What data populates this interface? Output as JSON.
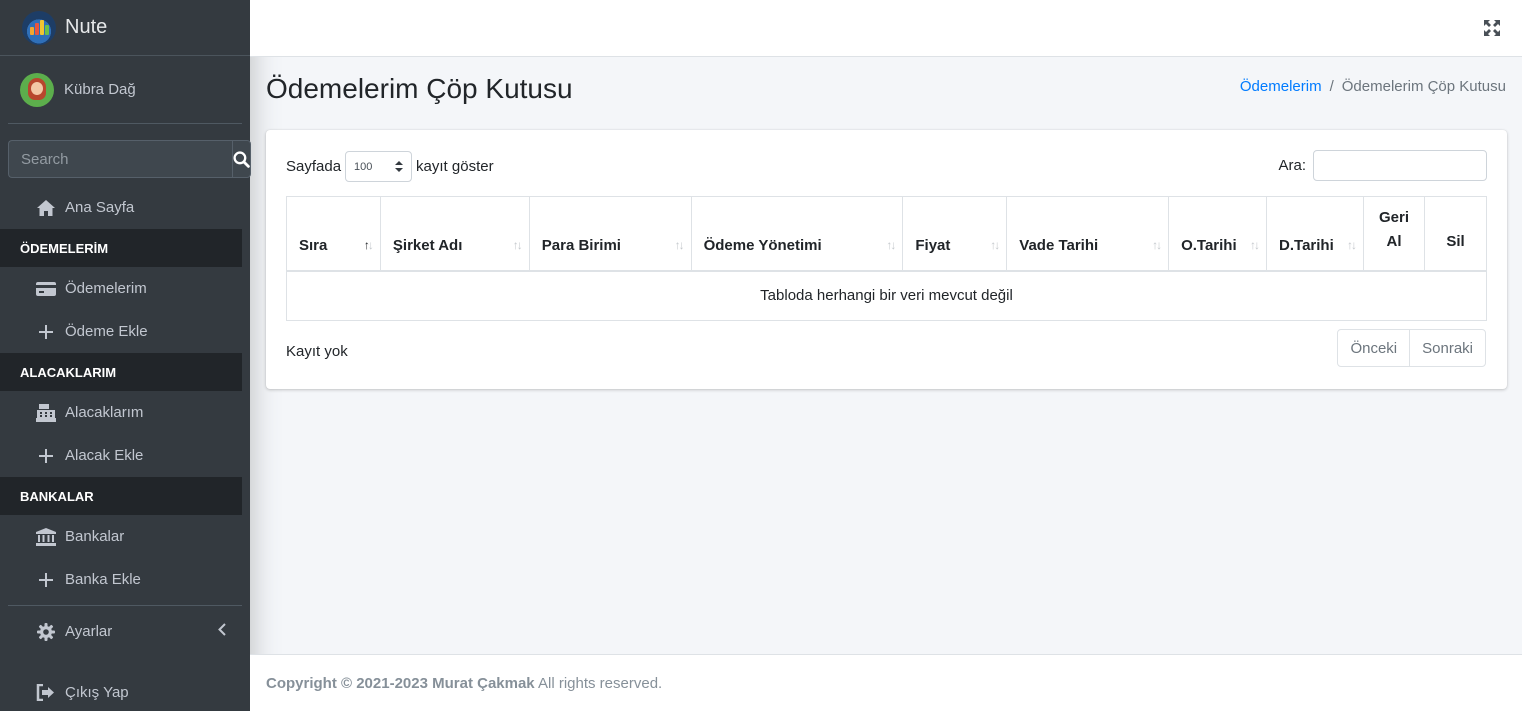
{
  "brand": {
    "name": "Nute",
    "icon": "chart-logo-icon"
  },
  "user": {
    "name": "Kübra Dağ",
    "icon": "avatar"
  },
  "search": {
    "placeholder": "Search",
    "icon": "search-icon"
  },
  "sidebar": {
    "home": {
      "label": "Ana Sayfa",
      "icon": "home-icon"
    },
    "sections": [
      {
        "header": "ÖDEMELERİM",
        "items": [
          {
            "label": "Ödemelerim",
            "icon": "credit-card-icon"
          },
          {
            "label": "Ödeme Ekle",
            "icon": "plus-icon"
          }
        ]
      },
      {
        "header": "ALACAKLARIM",
        "items": [
          {
            "label": "Alacaklarım",
            "icon": "cash-register-icon"
          },
          {
            "label": "Alacak Ekle",
            "icon": "plus-icon"
          }
        ]
      },
      {
        "header": "BANKALAR",
        "items": [
          {
            "label": "Bankalar",
            "icon": "bank-icon"
          },
          {
            "label": "Banka Ekle",
            "icon": "plus-icon"
          }
        ]
      }
    ],
    "settings": {
      "label": "Ayarlar",
      "icon": "gear-icon",
      "chevron": "chevron-left-icon"
    },
    "logout": {
      "label": "Çıkış Yap",
      "icon": "sign-out-icon"
    }
  },
  "topbar": {
    "fullscreen_icon": "expand-icon"
  },
  "page": {
    "title": "Ödemelerim Çöp Kutusu",
    "breadcrumb": {
      "link": "Ödemelerim",
      "separator": "/",
      "current": "Ödemelerim Çöp Kutusu"
    }
  },
  "table_controls": {
    "length_prefix": "Sayfada",
    "length_value": "100",
    "length_suffix": "kayıt göster",
    "search_label": "Ara:"
  },
  "table": {
    "columns": [
      "Sıra",
      "Şirket Adı",
      "Para Birimi",
      "Ödeme Yönetimi",
      "Fiyat",
      "Vade Tarihi",
      "O.Tarihi",
      "D.Tarihi"
    ],
    "restore_column": {
      "line1": "Geri",
      "line2": "Al"
    },
    "delete_column": "Sil",
    "empty_message": "Tabloda herhangi bir veri mevcut değil",
    "info": "Kayıt yok",
    "prev": "Önceki",
    "next": "Sonraki"
  },
  "footer": {
    "copyright": "Copyright © 2021-2023 Murat Çakmak",
    "rights": " All rights reserved."
  },
  "colors": {
    "sidebar_bg": "#343a40",
    "section_header_bg": "#212529",
    "link": "#007bff",
    "content_bg": "#f4f6f9"
  }
}
